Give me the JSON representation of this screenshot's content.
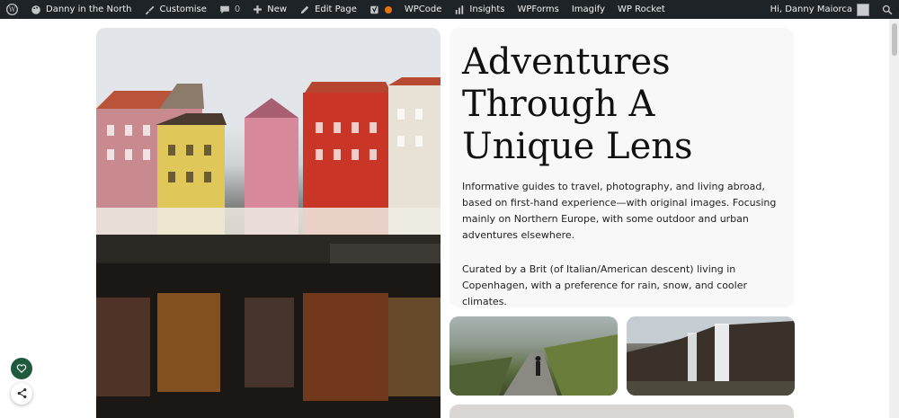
{
  "admin_bar": {
    "site_name": "Danny in the North",
    "customise": "Customise",
    "comments_count": "0",
    "new": "New",
    "edit_page": "Edit Page",
    "wpcode": "WPCode",
    "insights": "Insights",
    "wpforms": "WPForms",
    "imagify": "Imagify",
    "wp_rocket": "WP Rocket",
    "greeting": "Hi, Danny Maiorca"
  },
  "hero": {
    "title": "Adventures Through A Unique Lens",
    "description": "Informative guides to travel, photography, and living abroad, based on first-hand experience—with original images. Focusing mainly on Northern Europe, with some outdoor and urban adventures elsewhere.",
    "curated": "Curated by a Brit (of Italian/American descent) living in Copenhagen, with a preference for rain, snow, and cooler climates."
  },
  "colors": {
    "admin_bar_bg": "#1d2327",
    "card_bg": "#f8f8f8",
    "like_button": "#1f5a3d",
    "status_dot": "#e8750b"
  },
  "icons": {
    "wordpress": "wordpress-icon",
    "site": "palette-icon",
    "customise": "brush-icon",
    "comments": "comment-icon",
    "new": "plus-icon",
    "edit": "pencil-icon",
    "yoast": "yoast-icon",
    "insights": "bar-chart-icon",
    "search": "search-icon",
    "like": "heart-icon",
    "share": "share-icon"
  }
}
